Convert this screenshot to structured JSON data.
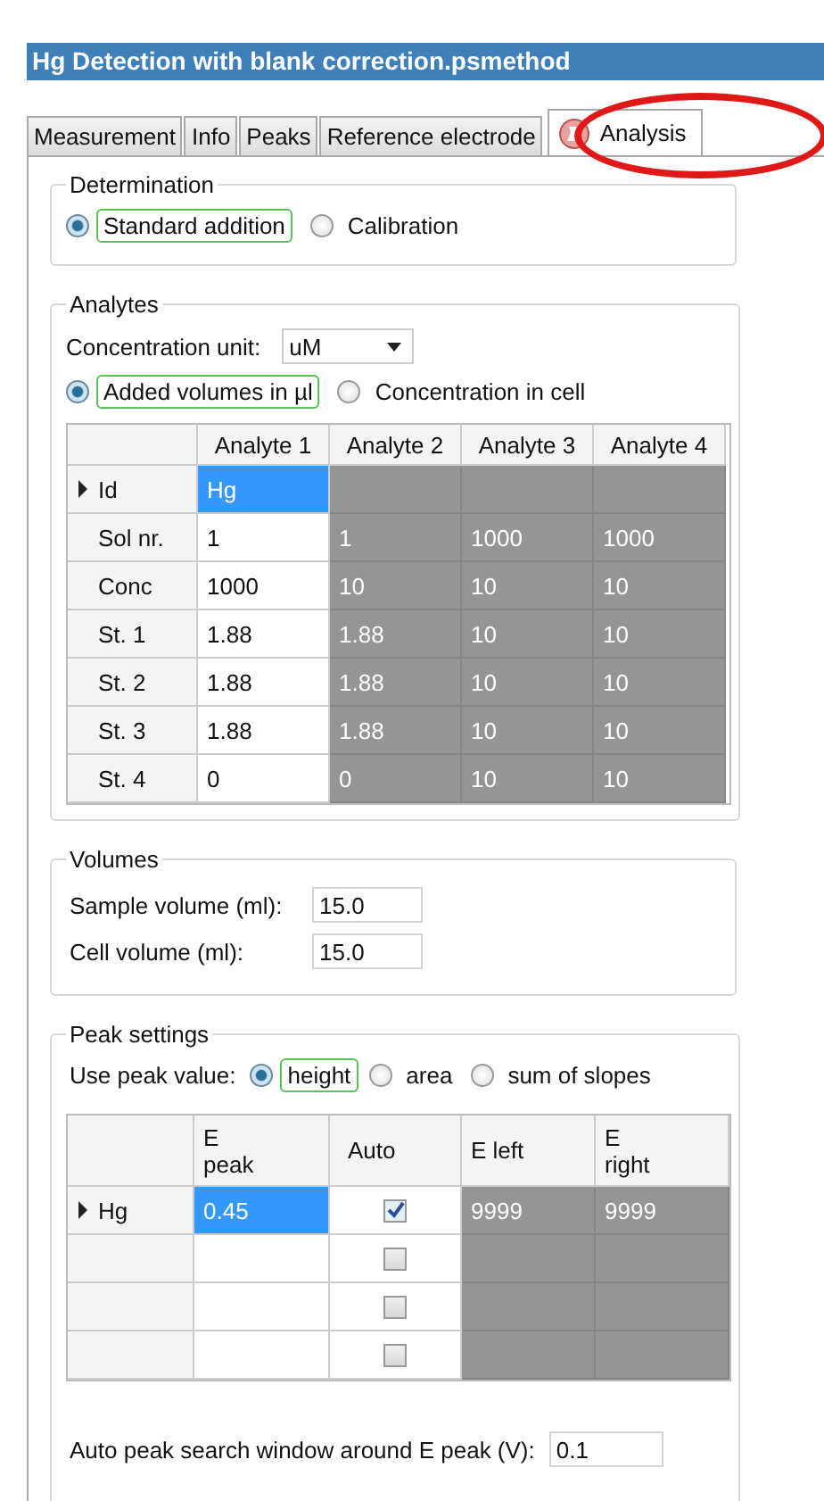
{
  "window": {
    "title": "Hg Detection with blank correction.psmethod"
  },
  "tabs": [
    {
      "label": "Measurement",
      "selected": false,
      "icon": false
    },
    {
      "label": "Info",
      "selected": false,
      "icon": false
    },
    {
      "label": "Peaks",
      "selected": false,
      "icon": false
    },
    {
      "label": "Reference electrode",
      "selected": false,
      "icon": false
    },
    {
      "label": "Analysis",
      "selected": true,
      "icon": true
    }
  ],
  "determination": {
    "title": "Determination",
    "options": [
      {
        "label": "Standard addition",
        "selected": true,
        "focused": true
      },
      {
        "label": "Calibration",
        "selected": false,
        "focused": false
      }
    ]
  },
  "analytes": {
    "title": "Analytes",
    "unit_label": "Concentration unit:",
    "unit_value": "uM",
    "options": [
      {
        "label": "Added volumes in µl",
        "selected": true,
        "focused": true
      },
      {
        "label": "Concentration in cell",
        "selected": false,
        "focused": false
      }
    ],
    "table": {
      "columns": [
        "Analyte 1",
        "Analyte 2",
        "Analyte 3",
        "Analyte 4"
      ],
      "rows": [
        {
          "header": "Id",
          "current": true,
          "cells": [
            {
              "text": "Hg",
              "disabled": false,
              "selected": true
            },
            {
              "disabled": true,
              "selected": false
            },
            {
              "disabled": true,
              "selected": false
            },
            {
              "disabled": true,
              "selected": false
            }
          ]
        },
        {
          "header": "Sol nr.",
          "current": false,
          "cells": [
            {
              "text": "1",
              "disabled": false,
              "selected": false
            },
            {
              "text": "1",
              "disabled": true,
              "selected": false
            },
            {
              "text": "1000",
              "disabled": true,
              "selected": false
            },
            {
              "text": "1000",
              "disabled": true,
              "selected": false
            }
          ]
        },
        {
          "header": "Conc",
          "current": false,
          "cells": [
            {
              "text": "1000",
              "disabled": false,
              "selected": false
            },
            {
              "text": "10",
              "disabled": true,
              "selected": false
            },
            {
              "text": "10",
              "disabled": true,
              "selected": false
            },
            {
              "text": "10",
              "disabled": true,
              "selected": false
            }
          ]
        },
        {
          "header": "St. 1",
          "current": false,
          "cells": [
            {
              "text": "1.88",
              "disabled": false,
              "selected": false
            },
            {
              "text": "1.88",
              "disabled": true,
              "selected": false
            },
            {
              "text": "10",
              "disabled": true,
              "selected": false
            },
            {
              "text": "10",
              "disabled": true,
              "selected": false
            }
          ]
        },
        {
          "header": "St. 2",
          "current": false,
          "cells": [
            {
              "text": "1.88",
              "disabled": false,
              "selected": false
            },
            {
              "text": "1.88",
              "disabled": true,
              "selected": false
            },
            {
              "text": "10",
              "disabled": true,
              "selected": false
            },
            {
              "text": "10",
              "disabled": true,
              "selected": false
            }
          ]
        },
        {
          "header": "St. 3",
          "current": false,
          "cells": [
            {
              "text": "1.88",
              "disabled": false,
              "selected": false
            },
            {
              "text": "1.88",
              "disabled": true,
              "selected": false
            },
            {
              "text": "10",
              "disabled": true,
              "selected": false
            },
            {
              "text": "10",
              "disabled": true,
              "selected": false
            }
          ]
        },
        {
          "header": "St. 4",
          "current": false,
          "cells": [
            {
              "text": "0",
              "disabled": false,
              "selected": false
            },
            {
              "text": "0",
              "disabled": true,
              "selected": false
            },
            {
              "text": "10",
              "disabled": true,
              "selected": false
            },
            {
              "text": "10",
              "disabled": true,
              "selected": false
            }
          ]
        }
      ]
    }
  },
  "volumes": {
    "title": "Volumes",
    "fields": [
      {
        "label": "Sample volume (ml):",
        "value": "15.0"
      },
      {
        "label": "Cell volume (ml):",
        "value": "15.0"
      }
    ]
  },
  "peak_settings": {
    "title": "Peak settings",
    "value_label": "Use peak value:",
    "options": [
      {
        "label": "height",
        "selected": true,
        "focused": true
      },
      {
        "label": "area",
        "selected": false,
        "focused": false
      },
      {
        "label": "sum of slopes",
        "selected": false,
        "focused": false
      }
    ],
    "table": {
      "columns": [
        "E\npeak",
        "Auto",
        "E left",
        "E\nright"
      ],
      "rows": [
        {
          "header": "Hg",
          "current": true,
          "cells": [
            {
              "kind": "text",
              "text": "0.45",
              "disabled": false,
              "selected": true
            },
            {
              "kind": "check",
              "checked": true
            },
            {
              "kind": "text",
              "text": "9999",
              "disabled": true,
              "selected": false
            },
            {
              "kind": "text",
              "text": "9999",
              "disabled": true,
              "selected": false
            }
          ]
        },
        {
          "current": false,
          "cells": [
            {
              "kind": "text",
              "disabled": false,
              "selected": false
            },
            {
              "kind": "check",
              "checked": false
            },
            {
              "kind": "text",
              "disabled": true,
              "selected": false
            },
            {
              "kind": "text",
              "disabled": true,
              "selected": false
            }
          ]
        },
        {
          "current": false,
          "cells": [
            {
              "kind": "text",
              "disabled": false,
              "selected": false
            },
            {
              "kind": "check",
              "checked": false
            },
            {
              "kind": "text",
              "disabled": true,
              "selected": false
            },
            {
              "kind": "text",
              "disabled": true,
              "selected": false
            }
          ]
        },
        {
          "current": false,
          "cells": [
            {
              "kind": "text",
              "disabled": false,
              "selected": false
            },
            {
              "kind": "check",
              "checked": false
            },
            {
              "kind": "text",
              "disabled": true,
              "selected": false
            },
            {
              "kind": "text",
              "disabled": true,
              "selected": false
            }
          ]
        }
      ]
    },
    "search_window": {
      "label": "Auto peak search window around E peak (V):",
      "value": "0.1"
    }
  }
}
